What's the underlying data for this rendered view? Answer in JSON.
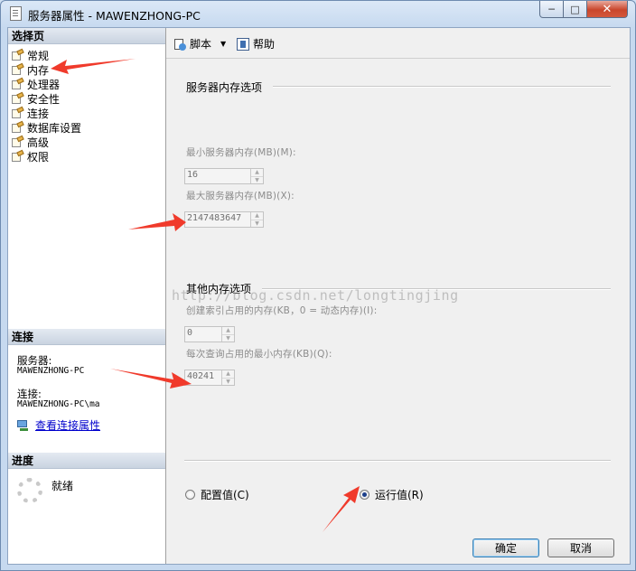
{
  "window": {
    "title": "服务器属性 - MAWENZHONG-PC"
  },
  "left": {
    "pages_header": "选择页",
    "pages": [
      {
        "label": "常规"
      },
      {
        "label": "内存"
      },
      {
        "label": "处理器"
      },
      {
        "label": "安全性"
      },
      {
        "label": "连接"
      },
      {
        "label": "数据库设置"
      },
      {
        "label": "高级"
      },
      {
        "label": "权限"
      }
    ],
    "connection_header": "连接",
    "server_label": "服务器:",
    "server_value": "MAWENZHONG-PC",
    "connection_label": "连接:",
    "connection_value": "MAWENZHONG-PC\\ma",
    "view_link": "查看连接属性",
    "progress_header": "进度",
    "status": "就绪"
  },
  "toolbar": {
    "script": "脚本",
    "help": "帮助"
  },
  "server_memory": {
    "group_title": "服务器内存选项",
    "min_label": "最小服务器内存(MB)(M):",
    "min_value": "16",
    "max_label": "最大服务器内存(MB)(X):",
    "max_value": "2147483647"
  },
  "other_memory": {
    "group_title": "其他内存选项",
    "index_label": "创建索引占用的内存(KB，0 = 动态内存)(I):",
    "index_value": "0",
    "query_label": "每次查询占用的最小内存(KB)(Q):",
    "query_value": "40241"
  },
  "watermark": "http://blog.csdn.net/longtingjing",
  "options": {
    "configured": "配置值(C)",
    "running": "运行值(R)",
    "selected": "running"
  },
  "buttons": {
    "ok": "确定",
    "cancel": "取消"
  },
  "colors": {
    "annotation_arrow": "#f03a2b"
  }
}
